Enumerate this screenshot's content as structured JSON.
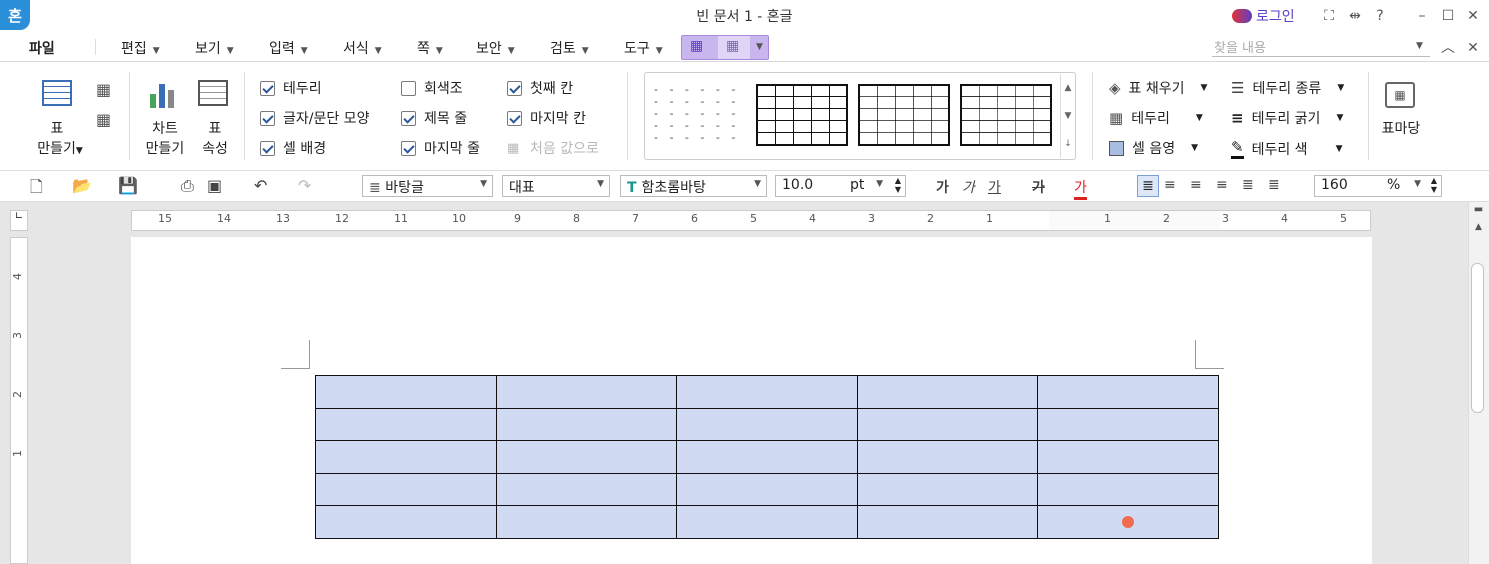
{
  "window": {
    "title": "빈 문서 1 - 혼글",
    "logo": "혼",
    "login_label": "로그인"
  },
  "menu": {
    "file": "파일",
    "items": [
      "편집",
      "보기",
      "입력",
      "서식",
      "쪽",
      "보안",
      "검토",
      "도구"
    ],
    "search_placeholder": "찾을 내용"
  },
  "ribbon": {
    "table_create": [
      "표",
      "만들기"
    ],
    "chart_create": [
      "차트",
      "만들기"
    ],
    "table_props": [
      "표",
      "속성"
    ],
    "options": [
      {
        "label": "테두리",
        "checked": true,
        "enabled": true
      },
      {
        "label": "글자/문단 모양",
        "checked": true,
        "enabled": true
      },
      {
        "label": "셀 배경",
        "checked": true,
        "enabled": true
      },
      {
        "label": "회색조",
        "checked": false,
        "enabled": true
      },
      {
        "label": "제목 줄",
        "checked": true,
        "enabled": true
      },
      {
        "label": "마지막 줄",
        "checked": true,
        "enabled": true
      },
      {
        "label": "첫째 칸",
        "checked": true,
        "enabled": true
      },
      {
        "label": "마지막 칸",
        "checked": true,
        "enabled": true
      },
      {
        "label": "처음 값으로",
        "checked": false,
        "enabled": false
      }
    ],
    "right": {
      "fill": "표 채우기",
      "border": "테두리",
      "cell_shade": "셀 음영",
      "border_type": "테두리 종류",
      "border_width": "테두리 굵기",
      "border_color": "테두리 색",
      "table_madang": "표마당"
    }
  },
  "format": {
    "style": "바탕글",
    "lang": "대표",
    "font": "함초롬바탕",
    "size": "10.0",
    "size_unit": "pt",
    "zoom": "160",
    "zoom_unit": "%"
  },
  "ruler": {
    "h_numbers": [
      "15",
      "14",
      "13",
      "12",
      "11",
      "10",
      "9",
      "8",
      "7",
      "6",
      "5",
      "4",
      "3",
      "2",
      "1",
      "1",
      "2",
      "3",
      "4",
      "5"
    ],
    "v_numbers": [
      "4",
      "3",
      "2",
      "1"
    ]
  },
  "document": {
    "table_rows": 5,
    "table_cols": 5,
    "cell_color": "#d0dbf3"
  },
  "colors": {
    "accent": "#2a8fd8",
    "ribbon_tab": "#c9b6ef"
  }
}
